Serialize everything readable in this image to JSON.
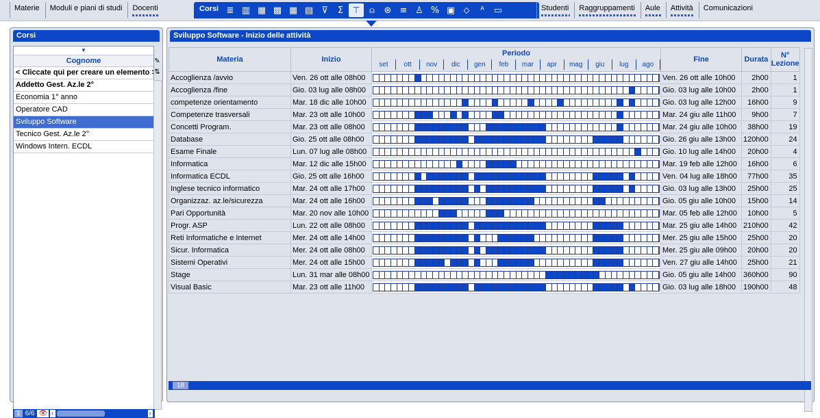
{
  "menu": {
    "left_items": [
      "Materie",
      "Moduli e piani di studi",
      "Docenti"
    ],
    "active_tab": "Corsi",
    "right_items": [
      "Studenti",
      "Raggruppamenti",
      "Aule",
      "Attività",
      "Comunicazioni"
    ]
  },
  "toolbar_icons": [
    "list-icon",
    "columns-icon",
    "person-grid-icon",
    "calendar-grid-icon",
    "grid-icon",
    "grid-alt-icon",
    "filter-icon",
    "sum-icon",
    "timeline-icon",
    "group-icon",
    "wheel-icon",
    "list-lines-icon",
    "person-icon",
    "percent-icon",
    "table-icon",
    "tag-icon",
    "text-style-icon",
    "panel-icon"
  ],
  "left_panel": {
    "title": "Corsi",
    "column_header": "Cognome",
    "rows": [
      {
        "label": "< Cliccate qui per creare un elemento >",
        "bold": true
      },
      {
        "label": "Addetto Gest. Az.le  2°",
        "bold": true
      },
      {
        "label": "Economia 1° anno",
        "bold": false
      },
      {
        "label": "Operatore CAD",
        "bold": false
      },
      {
        "label": "Sviluppo Software",
        "bold": false,
        "selected": true
      },
      {
        "label": "Tecnico Gest. Az.le 2°",
        "bold": false
      },
      {
        "label": "Windows Intern. ECDL",
        "bold": false
      }
    ],
    "footer": {
      "page": "1",
      "count": "6/6"
    }
  },
  "right_panel": {
    "title": "Sviluppo Software - Inizio delle attività",
    "headers": {
      "materia": "Materia",
      "inizio": "Inizio",
      "periodo": "Periodo",
      "fine": "Fine",
      "durata": "Durata",
      "lezioni": "N° Lezione"
    },
    "months": [
      "set",
      "ott",
      "nov",
      "dic",
      "gen",
      "feb",
      "mar",
      "apr",
      "mag",
      "giu",
      "lug",
      "ago"
    ],
    "rows": [
      {
        "materia": "Accoglienza /avvio",
        "inizio": "Ven. 26 ott alle 08h00",
        "fine": "Ven. 26 ott alle 10h00",
        "durata": "2h00",
        "lezioni": "1",
        "active_weeks": [
          7
        ]
      },
      {
        "materia": "Accoglienza /fine",
        "inizio": "Gio. 03 lug alle 08h00",
        "fine": "Gio. 03 lug alle 10h00",
        "durata": "2h00",
        "lezioni": "1",
        "active_weeks": [
          43
        ]
      },
      {
        "materia": "competenze orientamento",
        "inizio": "Mar. 18 dic alle 10h00",
        "fine": "Gio. 03 lug alle 12h00",
        "durata": "16h00",
        "lezioni": "9",
        "active_weeks": [
          15,
          20,
          26,
          31,
          41,
          43
        ]
      },
      {
        "materia": "Competenze trasversali",
        "inizio": "Mar. 23 ott alle 10h00",
        "fine": "Mar. 24 giu alle 11h00",
        "durata": "9h00",
        "lezioni": "7",
        "active_weeks": [
          7,
          8,
          9,
          13,
          15,
          20,
          21,
          41
        ]
      },
      {
        "materia": "Concetti Program.",
        "inizio": "Mar. 23 ott alle 08h00",
        "fine": "Mar. 24 giu alle 10h00",
        "durata": "38h00",
        "lezioni": "19",
        "active_weeks": [
          7,
          8,
          9,
          10,
          11,
          12,
          13,
          14,
          15,
          19,
          20,
          21,
          22,
          23,
          24,
          25,
          26,
          27,
          28,
          41
        ]
      },
      {
        "materia": "Database",
        "inizio": "Gio. 25 ott alle 08h00",
        "fine": "Gio. 26 giu alle 13h00",
        "durata": "120h00",
        "lezioni": "24",
        "active_weeks": [
          7,
          8,
          9,
          10,
          11,
          12,
          13,
          14,
          15,
          17,
          18,
          19,
          20,
          21,
          22,
          23,
          24,
          25,
          26,
          27,
          28,
          37,
          38,
          39,
          40,
          41
        ]
      },
      {
        "materia": "Esame Finale",
        "inizio": "Lun. 07 lug alle 08h00",
        "fine": "Gio. 10 lug alle 14h00",
        "durata": "20h00",
        "lezioni": "4",
        "active_weeks": [
          44
        ]
      },
      {
        "materia": "Informatica",
        "inizio": "Mar. 12 dic alle 15h00",
        "fine": "Mar. 19 feb alle 12h00",
        "durata": "16h00",
        "lezioni": "6",
        "active_weeks": [
          14,
          19,
          20,
          21,
          22,
          23
        ]
      },
      {
        "materia": "Informatica ECDL",
        "inizio": "Gio. 25 ott alle 16h00",
        "fine": "Ven. 04 lug alle 18h00",
        "durata": "77h00",
        "lezioni": "35",
        "active_weeks": [
          7,
          9,
          10,
          11,
          12,
          13,
          14,
          15,
          17,
          18,
          19,
          20,
          21,
          22,
          23,
          24,
          25,
          26,
          27,
          28,
          37,
          38,
          39,
          40,
          41,
          43
        ]
      },
      {
        "materia": "Inglese tecnico informatico",
        "inizio": "Mar. 24 ott alle 17h00",
        "fine": "Gio. 03 lug alle 13h00",
        "durata": "25h00",
        "lezioni": "25",
        "active_weeks": [
          7,
          8,
          9,
          10,
          11,
          12,
          13,
          14,
          15,
          17,
          19,
          20,
          21,
          22,
          23,
          24,
          25,
          26,
          27,
          28,
          37,
          38,
          39,
          40,
          41,
          43
        ]
      },
      {
        "materia": "Organizzaz. az.le/sicurezza",
        "inizio": "Mar. 24 ott alle 16h00",
        "fine": "Gio. 05 giu alle 10h00",
        "durata": "15h00",
        "lezioni": "14",
        "active_weeks": [
          7,
          8,
          9,
          11,
          12,
          13,
          14,
          15,
          19,
          20,
          21,
          22,
          23,
          24,
          25,
          26,
          37,
          38
        ]
      },
      {
        "materia": "Pari Opportunità",
        "inizio": "Mar. 20 nov alle 10h00",
        "fine": "Mar. 05 feb alle 12h00",
        "durata": "10h00",
        "lezioni": "5",
        "active_weeks": [
          11,
          12,
          13,
          19,
          20,
          21
        ]
      },
      {
        "materia": "Progr. ASP",
        "inizio": "Lun. 22 ott alle 08h00",
        "fine": "Mar. 25 giu alle 14h00",
        "durata": "210h00",
        "lezioni": "42",
        "active_weeks": [
          7,
          8,
          9,
          10,
          11,
          12,
          13,
          14,
          15,
          17,
          18,
          19,
          20,
          21,
          22,
          23,
          24,
          25,
          26,
          27,
          28,
          37,
          38,
          39,
          40,
          41
        ]
      },
      {
        "materia": "Reti Informatiche e  Internet",
        "inizio": "Mer. 24 ott alle 14h00",
        "fine": "Mer. 25 giu alle 15h00",
        "durata": "25h00",
        "lezioni": "20",
        "active_weeks": [
          7,
          8,
          9,
          10,
          11,
          12,
          13,
          14,
          15,
          17,
          21,
          22,
          23,
          24,
          25,
          26,
          37,
          38,
          39,
          40,
          41
        ]
      },
      {
        "materia": "Sicur. Informatica",
        "inizio": "Mer. 24 ott alle 08h00",
        "fine": "Mer. 25 giu alle 09h00",
        "durata": "20h00",
        "lezioni": "20",
        "active_weeks": [
          7,
          8,
          9,
          10,
          11,
          12,
          13,
          14,
          15,
          17,
          19,
          20,
          21,
          22,
          23,
          24,
          25,
          26,
          27,
          28,
          37,
          38,
          39,
          40,
          41
        ]
      },
      {
        "materia": "Sistemi Operativi",
        "inizio": "Mer. 24 ott alle 15h00",
        "fine": "Ven. 27 giu alle 14h00",
        "durata": "25h00",
        "lezioni": "21",
        "active_weeks": [
          7,
          8,
          9,
          10,
          11,
          13,
          14,
          15,
          17,
          21,
          22,
          23,
          24,
          25,
          26,
          37,
          38,
          39,
          40,
          41
        ]
      },
      {
        "materia": "Stage",
        "inizio": "Lun. 31 mar alle 08h00",
        "fine": "Gio. 05 giu alle 14h00",
        "durata": "360h00",
        "lezioni": "90",
        "active_weeks": [
          29,
          30,
          31,
          32,
          33,
          34,
          35,
          36,
          37
        ]
      },
      {
        "materia": "Visual Basic",
        "inizio": "Mar. 23 ott alle 11h00",
        "fine": "Gio. 03 lug alle 18h00",
        "durata": "190h00",
        "lezioni": "48",
        "active_weeks": [
          7,
          8,
          9,
          10,
          11,
          12,
          13,
          14,
          15,
          17,
          18,
          19,
          20,
          21,
          22,
          23,
          24,
          25,
          26,
          27,
          28,
          37,
          38,
          39,
          40,
          41,
          43
        ]
      }
    ],
    "footer_count": "18"
  },
  "colors": {
    "accent": "#0b47c7",
    "panel_bg": "#dfe3ec",
    "selection": "#3f6cd0"
  }
}
